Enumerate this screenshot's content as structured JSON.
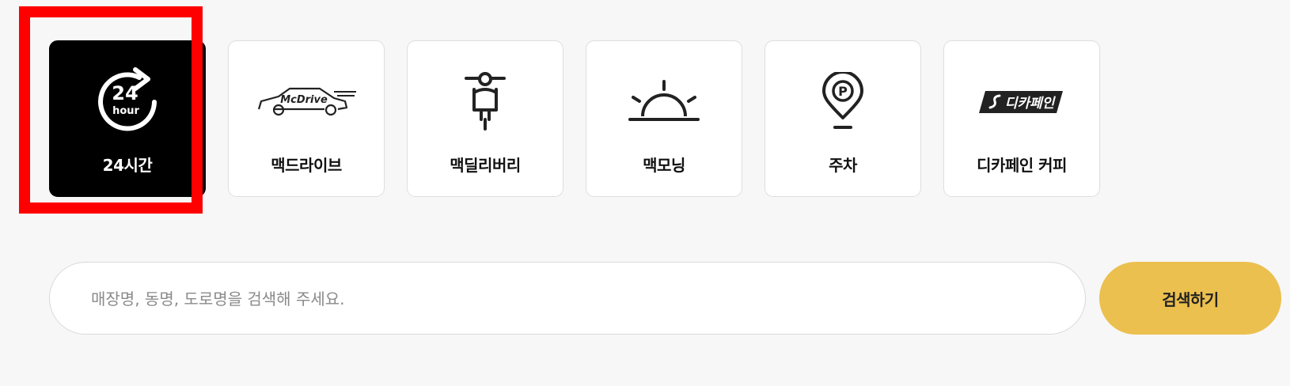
{
  "filters": [
    {
      "label": "24시간",
      "icon": "24-hour-icon",
      "active": true,
      "icon_text": "24",
      "icon_subtext": "hour"
    },
    {
      "label": "맥드라이브",
      "icon": "mcdrive-car-icon",
      "active": false,
      "icon_text": "McDrive"
    },
    {
      "label": "맥딜리버리",
      "icon": "scooter-icon",
      "active": false
    },
    {
      "label": "맥모닝",
      "icon": "sunrise-icon",
      "active": false
    },
    {
      "label": "주차",
      "icon": "parking-pin-icon",
      "active": false,
      "icon_text": "P"
    },
    {
      "label": "디카페인 커피",
      "icon": "decaf-logo-icon",
      "active": false,
      "icon_text": "디카페인"
    }
  ],
  "search": {
    "placeholder": "매장명, 동명, 도로명을 검색해 주세요.",
    "value": "",
    "button_label": "검색하기"
  },
  "colors": {
    "active_card": "#000000",
    "search_button": "#ebc04f",
    "highlight": "#ff0000"
  }
}
